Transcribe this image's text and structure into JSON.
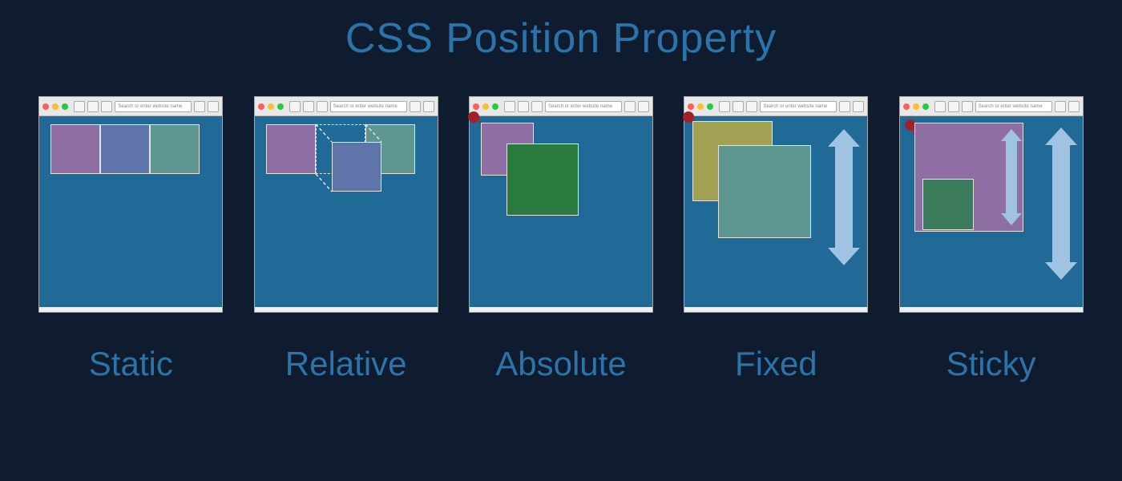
{
  "title": "CSS Position  Property",
  "address_placeholder": "Search or enter website name",
  "panels": [
    {
      "key": "static",
      "label": "Static"
    },
    {
      "key": "relative",
      "label": "Relative"
    },
    {
      "key": "absolute",
      "label": "Absolute"
    },
    {
      "key": "fixed",
      "label": "Fixed"
    },
    {
      "key": "sticky",
      "label": "Sticky"
    }
  ],
  "colors": {
    "background": "#0f1b2e",
    "panel_bg": "#216996",
    "text": "#2b73a8",
    "purple": "#8f6fa3",
    "blue": "#5f75aa",
    "teal": "#5e9690",
    "olive": "#a2a153",
    "green": "#2a7a3d",
    "arrow_blue": "#9fc3e0",
    "arrow_red": "#a22222"
  }
}
